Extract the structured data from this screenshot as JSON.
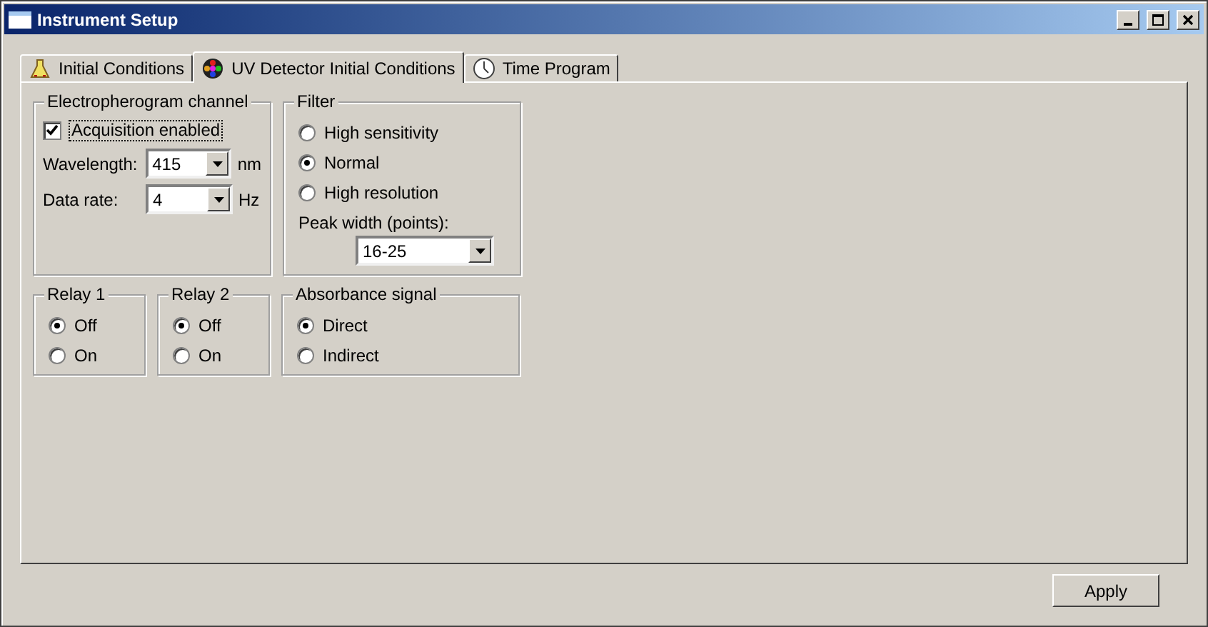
{
  "window": {
    "title": "Instrument Setup"
  },
  "tabs": [
    {
      "label": "Initial Conditions",
      "selected": false
    },
    {
      "label": "UV Detector Initial Conditions",
      "selected": true
    },
    {
      "label": "Time Program",
      "selected": false
    }
  ],
  "channel": {
    "title": "Electropherogram channel",
    "acquisition": {
      "label": "Acquisition enabled",
      "checked": true
    },
    "fields": [
      {
        "label": "Wavelength:",
        "value": "415",
        "unit": "nm"
      },
      {
        "label": "Data rate:",
        "value": "4",
        "unit": "Hz"
      }
    ]
  },
  "filter": {
    "title": "Filter",
    "options": [
      {
        "label": "High sensitivity",
        "selected": false
      },
      {
        "label": "Normal",
        "selected": true
      },
      {
        "label": "High resolution",
        "selected": false
      }
    ],
    "peak_width": {
      "label": "Peak width (points):",
      "value": "16-25"
    }
  },
  "relays": [
    {
      "title": "Relay 1",
      "options": [
        {
          "label": "Off",
          "selected": true
        },
        {
          "label": "On",
          "selected": false
        }
      ]
    },
    {
      "title": "Relay 2",
      "options": [
        {
          "label": "Off",
          "selected": true
        },
        {
          "label": "On",
          "selected": false
        }
      ]
    }
  ],
  "absorbance": {
    "title": "Absorbance signal",
    "options": [
      {
        "label": "Direct",
        "selected": true
      },
      {
        "label": "Indirect",
        "selected": false
      }
    ]
  },
  "buttons": [
    "Apply"
  ]
}
